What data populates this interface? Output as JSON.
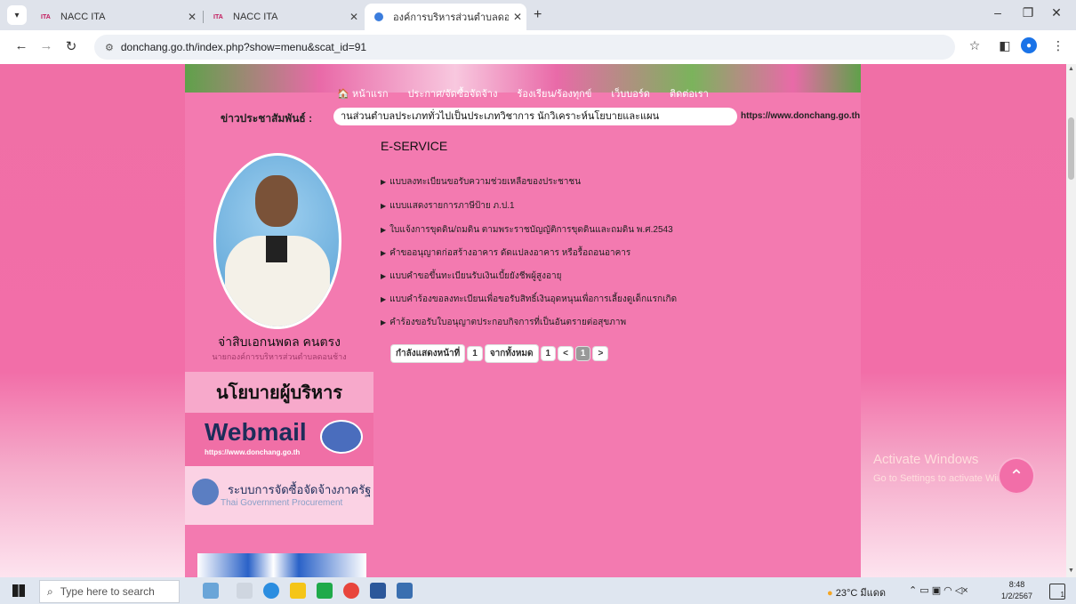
{
  "browser": {
    "tabs": [
      {
        "favicon": "ITA",
        "title": "NACC ITA"
      },
      {
        "favicon": "ITA",
        "title": "NACC ITA"
      },
      {
        "favicon": "globe",
        "title": "องค์การบริหารส่วนตำบลดอนช้าง (อ"
      }
    ],
    "new_tab_label": "+",
    "window_controls": {
      "minimize": "–",
      "maximize": "❐",
      "close": "✕"
    },
    "url": "donchang.go.th/index.php?show=menu&scat_id=91"
  },
  "site": {
    "nav": [
      "หน้าแรก",
      "ประกาศ/จัดซื้อจัดจ้าง",
      "ร้องเรียน/ร้องทุกข์",
      "เว็บบอร์ด",
      "ติดต่อเรา"
    ],
    "news_label": "ข่าวประชาสัมพันธ์ :",
    "news_ticker": "านส่วนตำบลประเภททั่วไปเป็นประเภทวิชาการ นักวิเคราะห์นโยบายและแผน",
    "news_url": "https://www.donchang.go.th",
    "sidebar": {
      "name": "จ่าสิบเอกนพดล คนตรง",
      "position": "นายกองค์การบริหารส่วนตำบลดอนช้าง",
      "policy_label": "นโยบายผู้บริหาร",
      "webmail_title": "Webmail",
      "webmail_url": "https://www.donchang.go.th",
      "procurement_th": "ระบบการจัดซื้อจัดจ้างภาครัฐ",
      "procurement_en": "Thai Government Procurement"
    },
    "section_title": "E-SERVICE",
    "items": [
      "แบบลงทะเบียนขอรับความช่วยเหลือของประชาชน",
      "แบบแสดงรายการภาษีป้าย ภ.ป.1",
      "ใบแจ้งการขุดดิน/ถมดิน ตามพระราชบัญญัติการขุดดินและถมดิน พ.ศ.2543",
      "คำขออนุญาตก่อสร้างอาคาร ดัดแปลงอาคาร หรือรื้อถอนอาคาร",
      "แบบคำขอขึ้นทะเบียนรับเงินเบี้ยยังชีพผู้สูงอายุ",
      "แบบคำร้องขอลงทะเบียนเพื่อขอรับสิทธิ์เงินอุดหนุนเพื่อการเลี้ยงดูเด็กแรกเกิด",
      "คำร้องขอรับใบอนุญาตประกอบกิจการที่เป็นอันตรายต่อสุขภาพ"
    ],
    "pager": {
      "showing_label": "กำลังแสดงหน้าที่",
      "current_page": "1",
      "of_label": "จากทั้งหมด",
      "total_pages": "1",
      "prev": "<",
      "page_button": "1",
      "next": ">"
    }
  },
  "os": {
    "activate_title": "Activate Windows",
    "activate_sub": "Go to Settings to activate Windows.",
    "search_placeholder": "Type here to search",
    "weather": "23°C มีแดด",
    "time": "8:48",
    "date": "1/2/2567",
    "notification_count": "1"
  },
  "colors": {
    "page_bg": "#f06fa6",
    "sidebar_panel": "#f7a9cb",
    "accent": "#c2185b"
  }
}
